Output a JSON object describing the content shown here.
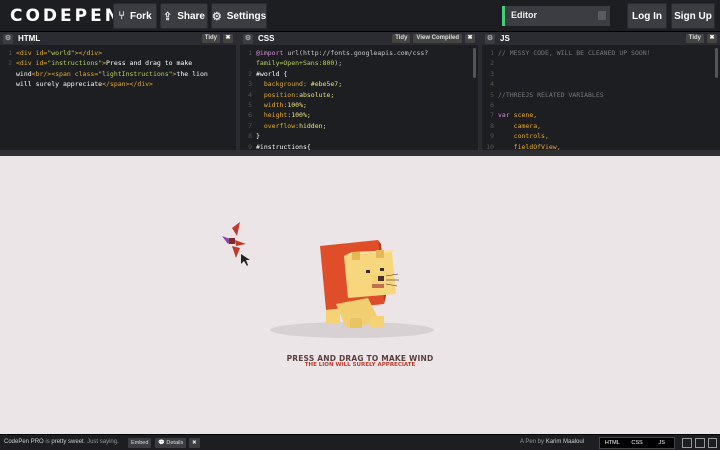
{
  "header": {
    "logo": "CODEPEN",
    "fork_label": "Fork",
    "share_label": "Share",
    "settings_label": "Settings",
    "editor_select": "Editor",
    "login_label": "Log In",
    "signup_label": "Sign Up"
  },
  "panes": {
    "html": {
      "title": "HTML",
      "tidy": "Tidy",
      "close": "✖"
    },
    "css": {
      "title": "CSS",
      "tidy": "Tidy",
      "compiled": "View Compiled",
      "close": "✖"
    },
    "js": {
      "title": "JS",
      "tidy": "Tidy",
      "close": "✖"
    }
  },
  "code": {
    "html": [
      {
        "n": "1",
        "a": "<div ",
        "b": "id=",
        "c": "\"world\"",
        "d": "></div>",
        "e": ""
      },
      {
        "n": "2",
        "a": "<div ",
        "b": "id=",
        "c": "\"instructions\"",
        "d": ">",
        "e": "Press and drag to make"
      }
    ],
    "html_wrap1_a": "wind",
    "html_wrap1_b": "<br/><span ",
    "html_wrap1_c": "class=",
    "html_wrap1_d": "\"lightInstructions\"",
    "html_wrap1_e": ">",
    "html_wrap1_f": "the lion",
    "html_wrap2_a": "will surely appreciate",
    "html_wrap2_b": "</span></div>",
    "css_lines": [
      {
        "n": "1",
        "t": "@import url(http://fonts.googleapis.com/css?"
      },
      {
        "n": "",
        "t": "family=Open+Sans:800);"
      },
      {
        "n": "2",
        "t": "#world {"
      },
      {
        "n": "3",
        "t": "  background: #ebe5e7;"
      },
      {
        "n": "4",
        "t": "  position:absolute;"
      },
      {
        "n": "5",
        "t": "  width:100%;"
      },
      {
        "n": "6",
        "t": "  height:100%;"
      },
      {
        "n": "7",
        "t": "  overflow:hidden;"
      },
      {
        "n": "8",
        "t": "}"
      },
      {
        "n": "9",
        "t": "#instructions{"
      }
    ],
    "js_lines": [
      {
        "n": "1",
        "t": "// MESSY CODE, WILL BE CLEANED UP SOON!"
      },
      {
        "n": "2",
        "t": ""
      },
      {
        "n": "3",
        "t": ""
      },
      {
        "n": "4",
        "t": ""
      },
      {
        "n": "5",
        "t": "//THREEJS RELATED VARIABLES"
      },
      {
        "n": "6",
        "t": ""
      },
      {
        "n": "7",
        "t": "var scene,"
      },
      {
        "n": "8",
        "t": "    camera,"
      },
      {
        "n": "9",
        "t": "    controls,"
      },
      {
        "n": "10",
        "t": "    fieldOfView,"
      }
    ]
  },
  "preview": {
    "instruction": "PRESS AND DRAG TO MAKE WIND",
    "light_instruction": "THE LION WILL SURELY APPRECIATE"
  },
  "footer": {
    "pro_msg_a": "CodePen PRO",
    "pro_msg_b": " is ",
    "pro_msg_c": "pretty sweet",
    "pro_msg_d": ". Just saying.",
    "embed_label": "Embed",
    "details_label": "Details",
    "close_label": "✖",
    "credit_prefix": "A Pen by ",
    "credit_author": "Karim Maaloul",
    "view_html": "HTML",
    "view_css": "CSS",
    "view_js": "JS"
  },
  "colors": {
    "accent": "#47cf73",
    "preview_bg": "#ebe5e7",
    "lion_mane": "#e04e29",
    "lion_body": "#f4d275"
  }
}
